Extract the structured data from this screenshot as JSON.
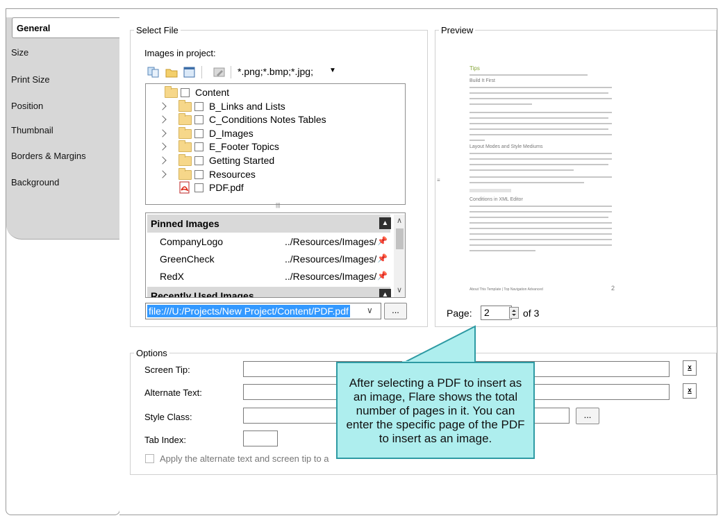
{
  "tabs": [
    {
      "label": "General"
    },
    {
      "label": "Size"
    },
    {
      "label": "Print Size"
    },
    {
      "label": "Position"
    },
    {
      "label": "Thumbnail"
    },
    {
      "label": "Borders & Margins"
    },
    {
      "label": "Background"
    }
  ],
  "select_file": {
    "legend": "Select File",
    "images_label": "Images in project:",
    "filter": "*.png;*.bmp;*.jpg;",
    "tree": [
      {
        "label": "Content",
        "expandable": false,
        "root": true
      },
      {
        "label": "B_Links and Lists",
        "expandable": true
      },
      {
        "label": "C_Conditions Notes Tables",
        "expandable": true
      },
      {
        "label": "D_Images",
        "expandable": true
      },
      {
        "label": "E_Footer Topics",
        "expandable": true
      },
      {
        "label": "Getting Started",
        "expandable": true
      },
      {
        "label": "Resources",
        "expandable": true
      },
      {
        "label": "PDF.pdf",
        "expandable": false,
        "pdf": true
      }
    ],
    "pinned_header": "Pinned Images",
    "pinned": [
      {
        "name": "CompanyLogo",
        "path": "../Resources/Images/"
      },
      {
        "name": "GreenCheck",
        "path": "../Resources/Images/"
      },
      {
        "name": "RedX",
        "path": "../Resources/Images/"
      }
    ],
    "recent_header": "Recently Used Images",
    "path": "file:///U:/Projects/New Project/Content/PDF.pdf",
    "browse_label": "..."
  },
  "preview": {
    "legend": "Preview",
    "doc_title": "Tips",
    "doc_sub1": "Build It First",
    "doc_sub2": "Layout Modes and Style Mediums",
    "doc_sub3": "Conditions in XML Editor",
    "doc_footer": "About This Template | Top Navigation Advanced",
    "doc_page_number": "2",
    "page_label": "Page:",
    "page_value": "2",
    "page_of": "of 3"
  },
  "options": {
    "legend": "Options",
    "screen_tip_label": "Screen Tip:",
    "alt_text_label": "Alternate Text:",
    "style_class_label": "Style Class:",
    "tab_index_label": "Tab Index:",
    "apply_label": "Apply the alternate text and screen tip to a",
    "book_icon_text": "x",
    "browse_label": "..."
  },
  "callout": {
    "text": "After selecting a PDF to insert as an image, Flare shows the total number of pages in it. You can enter the specific page of the PDF to insert as an image."
  },
  "colors": {
    "callout_fill": "#aeeeee",
    "callout_border": "#2d9aa3",
    "selection": "#3399ff",
    "tab_bg": "#d7d7d7"
  }
}
